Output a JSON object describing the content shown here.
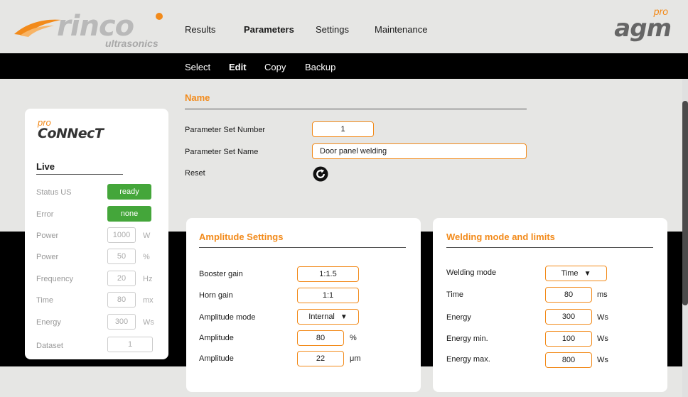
{
  "brand": {
    "logo_word": "rinco",
    "logo_sub": "ultrasonics",
    "partner_prefix": "pro",
    "partner_name": "agm"
  },
  "main_nav": [
    "Results",
    "Parameters",
    "Settings",
    "Maintenance"
  ],
  "main_nav_active": "Parameters",
  "sub_nav": [
    "Select",
    "Edit",
    "Copy",
    "Backup"
  ],
  "sub_nav_active": "Edit",
  "name_section": {
    "title": "Name",
    "set_number_label": "Parameter Set Number",
    "set_number": "1",
    "set_name_label": "Parameter Set Name",
    "set_name": "Door panel welding",
    "reset_label": "Reset"
  },
  "live": {
    "logo_prefix": "pro",
    "logo_name": "CoNNecT",
    "title": "Live",
    "status_label": "Status US",
    "status_value": "ready",
    "error_label": "Error",
    "error_value": "none",
    "power_label": "Power",
    "power_w": "1000",
    "power_w_unit": "W",
    "power_pct_label": "Power",
    "power_pct": "50",
    "power_pct_unit": "%",
    "frequency_label": "Frequency",
    "frequency": "20",
    "frequency_unit": "Hz",
    "time_label": "Time",
    "time": "80",
    "time_unit": "mx",
    "energy_label": "Energy",
    "energy": "300",
    "energy_unit": "Ws",
    "dataset_label": "Dataset",
    "dataset": "1"
  },
  "amplitude": {
    "title": "Amplitude Settings",
    "booster_label": "Booster gain",
    "booster": "1:1.5",
    "horn_label": "Horn gain",
    "horn": "1:1",
    "mode_label": "Amplitude mode",
    "mode": "Internal",
    "amp_pct_label": "Amplitude",
    "amp_pct": "80",
    "amp_pct_unit": "%",
    "amp_um_label": "Amplitude",
    "amp_um": "22",
    "amp_um_unit": "μm"
  },
  "welding": {
    "title": "Welding mode and limits",
    "mode_label": "Welding mode",
    "mode": "Time",
    "time_label": "Time",
    "time": "80",
    "time_unit": "ms",
    "energy_label": "Energy",
    "energy": "300",
    "energy_unit": "Ws",
    "energy_min_label": "Energy min.",
    "energy_min": "100",
    "energy_min_unit": "Ws",
    "energy_max_label": "Energy max.",
    "energy_max": "800",
    "energy_max_unit": "Ws"
  },
  "colors": {
    "accent": "#f28a1a",
    "status_green": "#44a63a",
    "nav_bar": "#000000"
  }
}
